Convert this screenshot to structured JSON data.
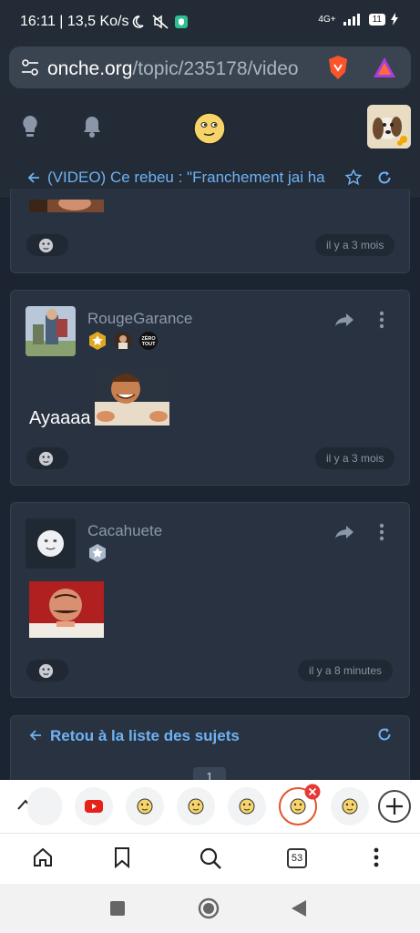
{
  "status_bar": {
    "time": "16:11 | 13,5 Ko/s",
    "network": "4G+",
    "battery": "11"
  },
  "browser": {
    "url_domain": "onche.org",
    "url_path": "/topic/235178/video",
    "tab_count": "53"
  },
  "topic": {
    "title": "(VIDEO) Ce rebeu : \"Franchement jai ha"
  },
  "posts": [
    {
      "timestamp": "il y a 3 mois"
    },
    {
      "username": "RougeGarance",
      "text": "Ayaaaa",
      "timestamp": "il y a 3 mois",
      "badge_label": "ZÉRO TOUT"
    },
    {
      "username": "Cacahuete",
      "timestamp": "il y a 8 minutes"
    }
  ],
  "navigation": {
    "back_to_list": "Retou à la liste des sujets",
    "page": "1"
  },
  "colors": {
    "accent": "#6fb2f2",
    "background": "#1b2430",
    "card": "#283241",
    "brave_orange": "#fb542b"
  }
}
